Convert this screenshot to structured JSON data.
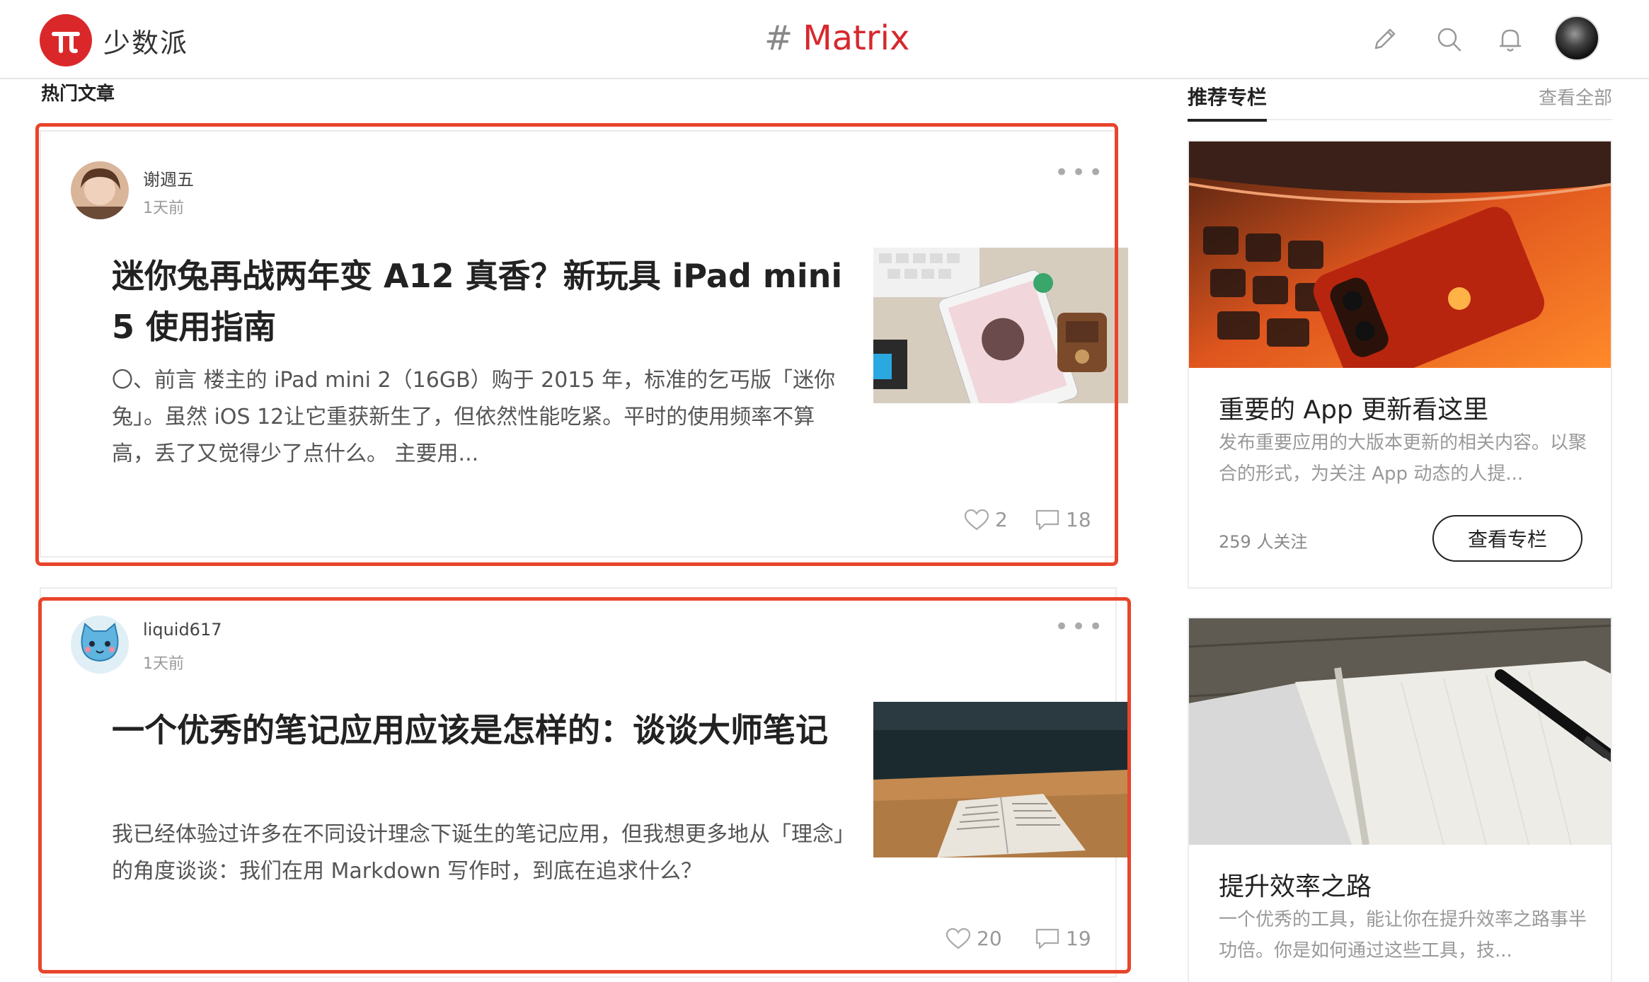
{
  "header": {
    "brand": "少数派",
    "hash": "#",
    "channel": "Matrix",
    "icons": [
      "pencil-icon",
      "search-icon",
      "bell-icon",
      "avatar"
    ]
  },
  "hot": {
    "title": "热门文章",
    "articles": [
      {
        "author": "谢週五",
        "time": "1天前",
        "title": "迷你兔再战两年变 A12 真香？新玩具 iPad mini 5 使用指南",
        "excerpt": "〇、前言 楼主的 iPad mini 2（16GB）购于 2015 年，标准的乞丐版「迷你兔」。虽然 iOS 12让它重获新生了，但依然性能吃紧。平时的使用频率不算高，丢了又觉得少了点什么。 主要用...",
        "likes": "2",
        "comments": "18"
      },
      {
        "author": "liquid617",
        "time": "1天前",
        "title": "一个优秀的笔记应用应该是怎样的：谈谈大师笔记",
        "excerpt": "我已经体验过许多在不同设计理念下诞生的笔记应用，但我想更多地从「理念」的角度谈谈：我们在用 Markdown 写作时，到底在追求什么？",
        "likes": "20",
        "comments": "19"
      }
    ]
  },
  "columns": {
    "title": "推荐专栏",
    "view_all": "查看全部",
    "items": [
      {
        "title": "重要的 App 更新看这里",
        "desc": "发布重要应用的大版本更新的相关内容。以聚合的形式，为关注 App 动态的人提...",
        "followers": "259 人关注",
        "button": "查看专栏"
      },
      {
        "title": "提升效率之路",
        "desc": "一个优秀的工具，能让你在提升效率之路事半功倍。你是如何通过这些工具，技..."
      }
    ]
  },
  "colors": {
    "brand_red": "#da282a",
    "highlight": "#e8452b"
  }
}
